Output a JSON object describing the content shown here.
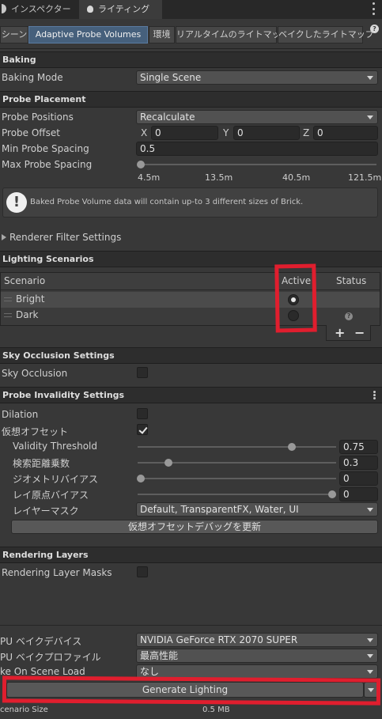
{
  "window_tabs": [
    {
      "label": "インスペクター",
      "icon": "info-icon"
    },
    {
      "label": "ライティング",
      "icon": "lightbulb-icon"
    }
  ],
  "sub_tabs": [
    "シーン",
    "Adaptive Probe Volumes",
    "環境",
    "リアルタイムのライトマップ",
    "ベイクしたライトマップ"
  ],
  "baking": {
    "header": "Baking",
    "mode_label": "Baking Mode",
    "mode_value": "Single Scene"
  },
  "probe_placement": {
    "header": "Probe Placement",
    "positions_label": "Probe Positions",
    "positions_value": "Recalculate",
    "offset_label": "Probe Offset",
    "offset_x_label": "X",
    "offset_x": "0",
    "offset_y_label": "Y",
    "offset_y": "0",
    "offset_z_label": "Z",
    "offset_z": "0",
    "min_spacing_label": "Min Probe Spacing",
    "min_spacing_value": "0.5",
    "max_spacing_label": "Max Probe Spacing",
    "max_spacing_ticks": [
      "4.5m",
      "13.5m",
      "40.5m",
      "121.5m"
    ],
    "max_spacing_level": 0,
    "info": "Baked Probe Volume data will contain up-to 3 different sizes of Brick."
  },
  "renderer_filter": {
    "label": "Renderer Filter Settings"
  },
  "lighting_scenarios": {
    "header": "Lighting Scenarios",
    "col_scenario": "Scenario",
    "col_active": "Active",
    "col_status": "Status",
    "rows": [
      {
        "name": "Bright",
        "active": true,
        "status": ""
      },
      {
        "name": "Dark",
        "active": false,
        "status": "?"
      }
    ],
    "add": "+",
    "remove": "−"
  },
  "sky_occlusion": {
    "header": "Sky Occlusion Settings",
    "label": "Sky Occlusion",
    "checked": false
  },
  "probe_invalidity": {
    "header": "Probe Invalidity Settings",
    "dilation_label": "Dilation",
    "dilation_checked": false,
    "virtual_offset_label": "仮想オフセット",
    "virtual_offset_checked": true,
    "validity_label": "Validity Threshold",
    "validity_value": "0.75",
    "search_label": "検索距離乗数",
    "search_value": "0.3",
    "geometry_label": "ジオメトリバイアス",
    "geometry_value": "0",
    "ray_label": "レイ原点バイアス",
    "ray_value": "0",
    "layer_label": "レイヤーマスク",
    "layer_value": "Default, TransparentFX, Water, UI",
    "update_button": "仮想オフセットデバッグを更新"
  },
  "rendering_layers": {
    "header": "Rendering Layers",
    "label": "Rendering Layer Masks",
    "checked": false
  },
  "footer": {
    "device_label": "PU ベイクデバイス",
    "device_value": "NVIDIA GeForce RTX 2070 SUPER",
    "profile_label": "PU ベイクプロファイル",
    "profile_value": "最高性能",
    "scene_load_label": "ke On Scene Load",
    "scene_load_value": "なし",
    "generate_button": "Generate Lighting",
    "size_label": "cenario Size",
    "size_value": "0.5 MB"
  },
  "colors": {
    "annotation": "#e01e2e",
    "selected_tab": "#46607c",
    "panel": "#383838"
  }
}
